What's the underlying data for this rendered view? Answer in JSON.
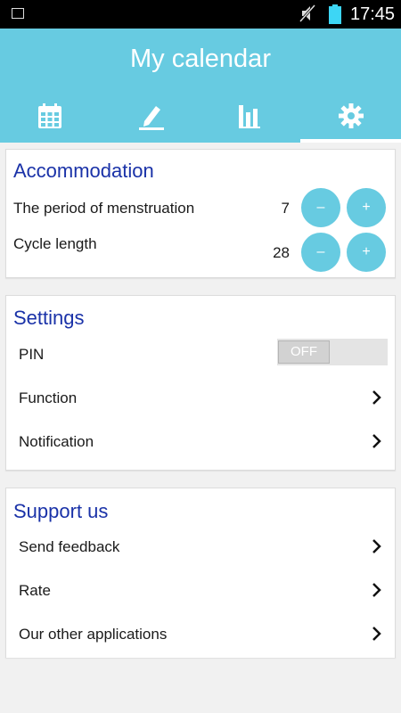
{
  "status_bar": {
    "time": "17:45"
  },
  "app": {
    "title": "My calendar"
  },
  "tabs": [
    {
      "icon": "calendar-icon"
    },
    {
      "icon": "pencil-icon"
    },
    {
      "icon": "bar-chart-icon"
    },
    {
      "icon": "gear-icon",
      "selected": true
    }
  ],
  "accommodation": {
    "title": "Accommodation",
    "rows": [
      {
        "label": "The period of menstruation",
        "value": "7",
        "minus": "–",
        "plus": "+"
      },
      {
        "label": "Cycle length",
        "value": "28",
        "minus": "–",
        "plus": "+"
      }
    ]
  },
  "settings": {
    "title": "Settings",
    "pin_label": "PIN",
    "pin_toggle": "OFF",
    "items": [
      {
        "label": "Function"
      },
      {
        "label": "Notification"
      }
    ]
  },
  "support": {
    "title": "Support us",
    "items": [
      {
        "label": "Send feedback"
      },
      {
        "label": "Rate"
      },
      {
        "label": "Our other applications"
      }
    ]
  },
  "colors": {
    "accent": "#67cbe1",
    "section_title": "#1a32a8",
    "background": "#f1f1f1"
  }
}
